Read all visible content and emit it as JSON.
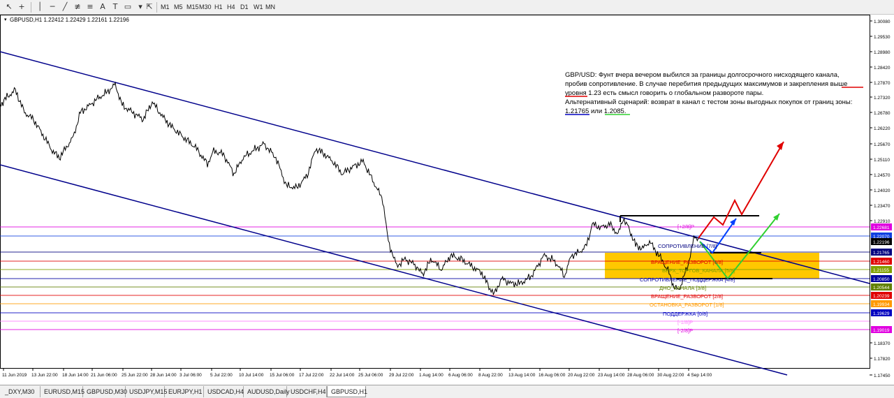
{
  "toolbar": {
    "tools": [
      "cursor-icon",
      "crosshair-icon",
      "vertical-line-icon",
      "horizontal-line-icon",
      "trendline-icon",
      "channel-icon",
      "fibonacci-icon",
      "text-icon",
      "label-icon",
      "shapes-icon"
    ],
    "timeframes": [
      "M1",
      "M5",
      "M15",
      "M30",
      "H1",
      "H4",
      "D1",
      "W1",
      "MN"
    ],
    "active_timeframe": "H1"
  },
  "chart": {
    "header": "GBPUSD,H1  1.22412 1.22429 1.22161 1.22196",
    "price_labels": [
      "1.30080",
      "1.29530",
      "1.28980",
      "1.28420",
      "1.27870",
      "1.27320",
      "1.26780",
      "1.26220",
      "1.25670",
      "1.25110",
      "1.24570",
      "1.24020",
      "1.23470",
      "1.22910"
    ],
    "price_labels_low": [
      "1.18370",
      "1.17820",
      "1.17450"
    ],
    "time_labels": [
      "11 Jun 2019",
      "13 Jun 22:00",
      "18 Jun 14:00",
      "21 Jun 06:00",
      "25 Jun 22:00",
      "28 Jun 14:00",
      "3 Jul 06:00",
      "5 Jul 22:00",
      "10 Jul 14:00",
      "15 Jul 06:00",
      "17 Jul 22:00",
      "22 Jul 14:00",
      "25 Jul 06:00",
      "29 Jul 22:00",
      "1 Aug 14:00",
      "6 Aug 06:00",
      "8 Aug 22:00",
      "13 Aug 14:00",
      "16 Aug 06:00",
      "20 Aug 22:00",
      "23 Aug 14:00",
      "28 Aug 06:00",
      "30 Aug 22:00",
      "4 Sep 14:00"
    ],
    "current_price": "1.22196",
    "colors": {
      "channel": "#00008b",
      "zone": "#ffc800",
      "bull": "#e00000",
      "alt_blue": "#0040ff",
      "alt_green": "#30d030",
      "bid": "#000000"
    },
    "murrey_levels": [
      {
        "label": "[+2/8]P",
        "price_tag": "1.22681",
        "color": "#e000e0"
      },
      {
        "label": "",
        "price_tag": "1.22070",
        "color": "#1040e0"
      },
      {
        "label": "СОПРОТИВЛЕНИЕ [7/8]",
        "price_tag": "1.21765",
        "color": "#000080"
      },
      {
        "label": "ВРАЩЕНИЕ_РАЗВОРОТ [6/8]",
        "price_tag": "1.21460",
        "color": "#e00000"
      },
      {
        "label": "ВЕРХ_ТОРГОВ_КАНАЛА [5/8]",
        "price_tag": "1.21155",
        "color": "#80a000"
      },
      {
        "label": "СОПРОТИВЛЕНИЕ_ПОДДЕРЖКА [4/8]",
        "price_tag": "1.20850",
        "color": "#0000a0"
      },
      {
        "label": "ДНО_КАНАЛА [3/8]",
        "price_tag": "1.20544",
        "color": "#608000"
      },
      {
        "label": "ВРАЩЕНИЕ_РАЗВОРОТ [2/8]",
        "price_tag": "1.20239",
        "color": "#e00000"
      },
      {
        "label": "ОСТАНОВКА_РАЗВОРОТ [1/8]",
        "price_tag": "1.19934",
        "color": "#ff9900"
      },
      {
        "label": "ПОДДЕРЖКА [0/8]",
        "price_tag": "1.19629",
        "color": "#0000c0"
      },
      {
        "label": "[-1/8]P",
        "price_tag": "",
        "color": "#ff80ff"
      },
      {
        "label": "[-2/8]P",
        "price_tag": "1.19019",
        "color": "#e000e0"
      }
    ],
    "annotation": {
      "line1": "GBP/USD: Фунт вчера вечером выбился за границы долгосрочного нисходящего канала,",
      "line2": "пробив сопротивление. В случае перебития предыдущих максимумов и закрепления выше",
      "line3": "уровня 1.23 есть смысл говорить о глобальном развороте пары.",
      "line4": "Альтернативный сценарий: возврат в канал с тестом зоны выгодных покупок от границ зоны:",
      "line5_a": "1.21765",
      "line5_b": " или ",
      "line5_c": "1.2085."
    }
  },
  "tabs": [
    "_DXY,M30",
    "EURUSD,M15",
    "GBPUSD,M30",
    "USDJPY,M15",
    "EURJPY,H1",
    "USDCAD,H4",
    "AUDUSD,Daily",
    "USDCHF,H4",
    "GBPUSD,H1"
  ],
  "active_tab": "GBPUSD,H1"
}
